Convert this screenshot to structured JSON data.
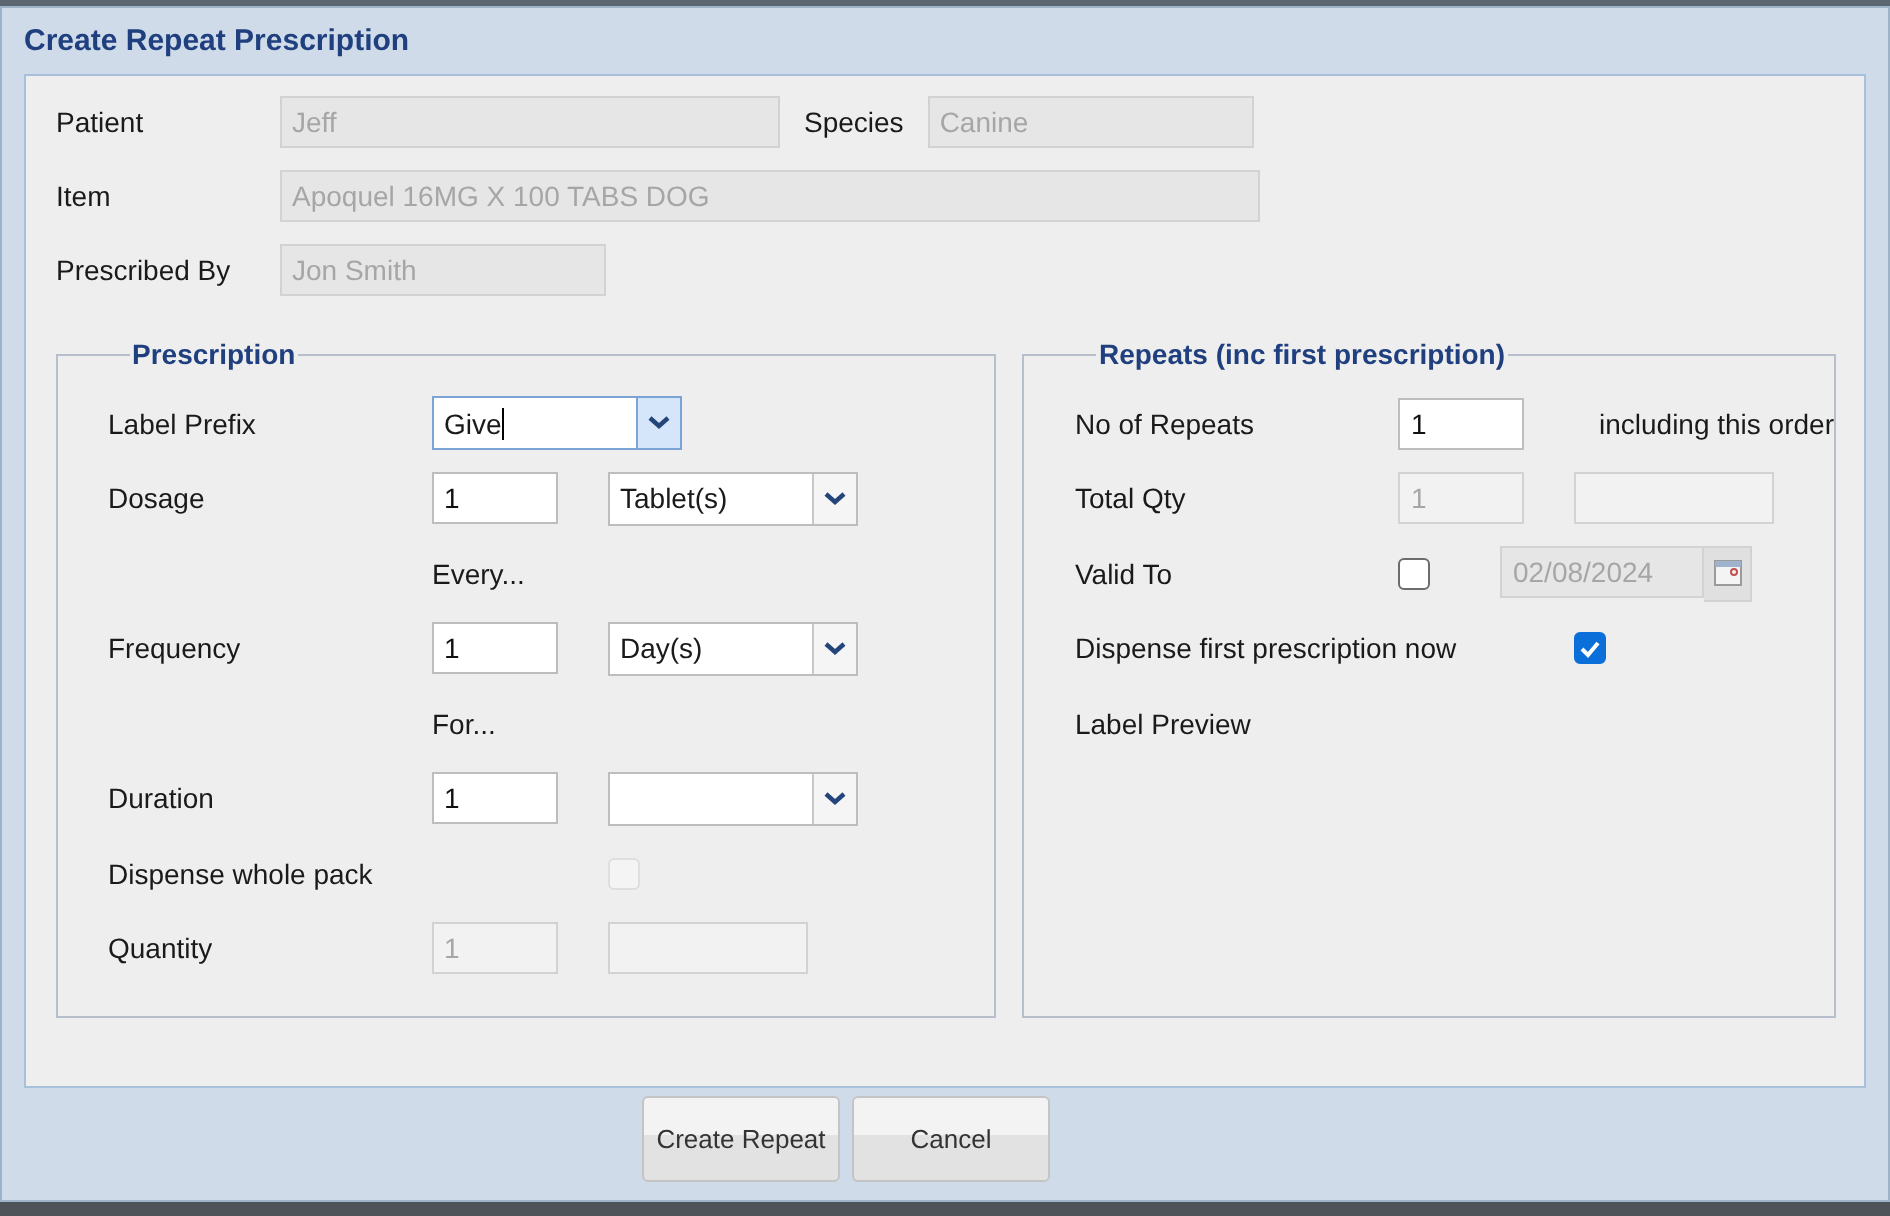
{
  "dialog": {
    "title": "Create Repeat Prescription"
  },
  "header": [
    {
      "label": "Patient",
      "value": "Jeff",
      "disabled": true,
      "side": {
        "label": "Species",
        "value": "Canine",
        "disabled": true
      }
    },
    {
      "label": "Item",
      "value": "Apoquel 16MG X 100 TABS DOG",
      "disabled": true
    },
    {
      "label": "Prescribed By",
      "value": "Jon Smith",
      "disabled": true
    }
  ],
  "prescription": {
    "title": "Prescription",
    "rows": [
      {
        "kind": "combo",
        "label": "Label Prefix",
        "value": "Give",
        "focused": true
      },
      {
        "kind": "input_combo",
        "label": "Dosage",
        "value": "1",
        "unit": "Tablet(s)"
      },
      {
        "kind": "note",
        "text": "Every..."
      },
      {
        "kind": "input_combo",
        "label": "Frequency",
        "value": "1",
        "unit": "Day(s)"
      },
      {
        "kind": "note",
        "text": "For..."
      },
      {
        "kind": "input_combo",
        "label": "Duration",
        "value": "1"
      },
      {
        "kind": "checkbox",
        "label": "Dispense whole pack",
        "checked": false,
        "disabled": true
      },
      {
        "kind": "two_inputs",
        "label": "Quantity",
        "value": "1",
        "disabled": true
      }
    ]
  },
  "repeats": {
    "title": "Repeats (inc first prescription)",
    "rows": [
      {
        "kind": "input_note",
        "label": "No of Repeats",
        "value": "1",
        "note": "including this order"
      },
      {
        "kind": "two_inputs",
        "label": "Total Qty",
        "value": "1",
        "disabled": true
      },
      {
        "kind": "checkbox_date",
        "label": "Valid To",
        "checked": false,
        "date": "02/08/2024",
        "disabled": true
      },
      {
        "kind": "checkbox",
        "label": "Dispense first prescription now",
        "checked": true,
        "disabled": false
      },
      {
        "kind": "label",
        "label": "Label Preview"
      }
    ]
  },
  "buttons": [
    {
      "label": "Create Repeat"
    },
    {
      "label": "Cancel"
    }
  ]
}
